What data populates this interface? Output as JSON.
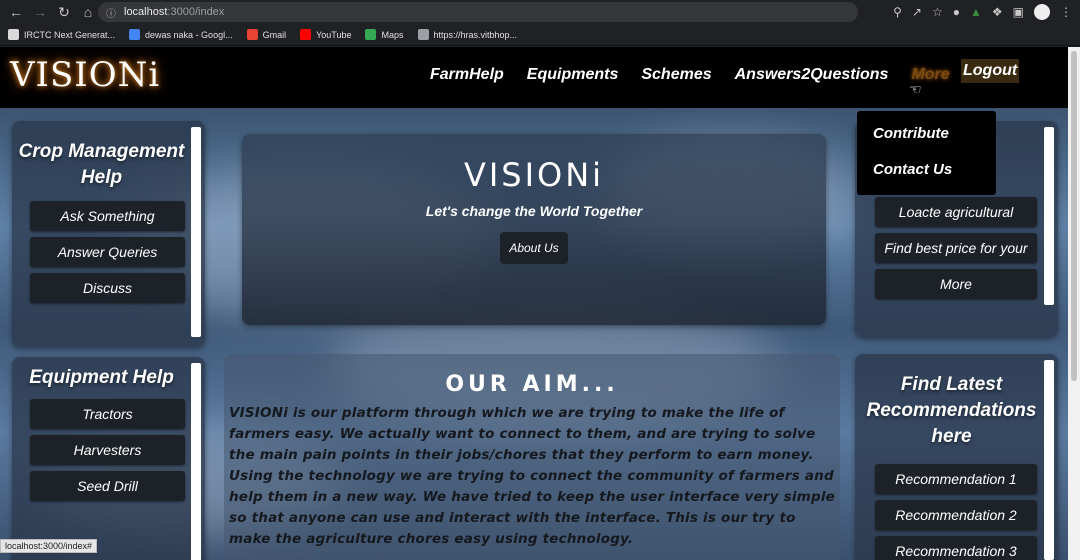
{
  "browser": {
    "url_host": "localhost",
    "url_path": ":3000/index",
    "bookmarks": [
      {
        "label": "IRCTC Next Generat...",
        "color": "#d9d9d9"
      },
      {
        "label": "dewas naka - Googl...",
        "color": "#4285f4"
      },
      {
        "label": "Gmail",
        "color": "#ea4335"
      },
      {
        "label": "YouTube",
        "color": "#ff0000"
      },
      {
        "label": "Maps",
        "color": "#34a853"
      },
      {
        "label": "https://hras.vitbhop...",
        "color": "#9aa0a6"
      }
    ],
    "status_url": "localhost:3000/index#"
  },
  "navbar": {
    "logo": "VISIONi",
    "links": [
      "FarmHelp",
      "Equipments",
      "Schemes",
      "Answers2Questions",
      "More"
    ],
    "logout": "Logout"
  },
  "dropdown": {
    "items": [
      "Contribute",
      "Contact Us"
    ]
  },
  "crop_panel": {
    "title": "Crop Management Help",
    "buttons": [
      "Ask Something",
      "Answer Queries",
      "Discuss"
    ]
  },
  "equipment_panel": {
    "title": "Equipment Help",
    "buttons": [
      "Tractors",
      "Harvesters",
      "Seed Drill"
    ]
  },
  "hero": {
    "title": "VISIONi",
    "subtitle": "Let's change the World Together",
    "button": "About Us"
  },
  "right_top_panel": {
    "buttons": [
      "Loacte agricultural",
      "Find best price for your",
      "More"
    ]
  },
  "aim": {
    "title": "OUR AIM...",
    "text": "VISIONi is our platform through which we are trying to make the life of farmers easy. We actually want to connect to them, and are trying to solve the main pain points in their jobs/chores that they perform to earn money. Using the technology we are trying to connect the community of farmers and help them in a new way. We have tried to keep the user interface very simple so that anyone can use and interact with the interface. This is our try to make the agriculture chores easy using technology."
  },
  "recommend_panel": {
    "title": "Find Latest Recommendations here",
    "buttons": [
      "Recommendation 1",
      "Recommendation 2",
      "Recommendation 3"
    ]
  }
}
